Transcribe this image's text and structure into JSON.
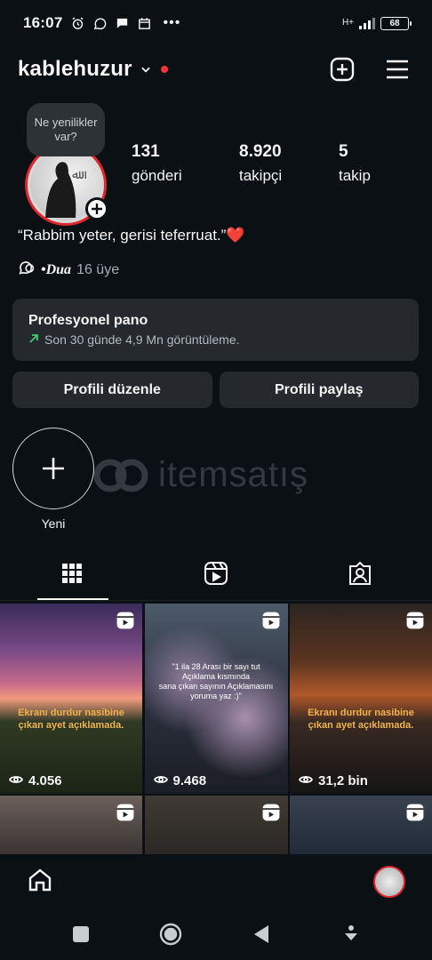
{
  "status_bar": {
    "time": "16:07",
    "battery": "68",
    "network": "H+",
    "left_icons": [
      "alarm-icon",
      "whatsapp-icon",
      "chat-icon",
      "calendar-icon"
    ]
  },
  "header": {
    "username": "kablehuzur"
  },
  "profile": {
    "note_bubble": "Ne yenilikler var?",
    "stats": [
      {
        "number": "131",
        "label": "gönderi"
      },
      {
        "number": "8.920",
        "label": "takipçi"
      },
      {
        "number": "5",
        "label": "takip"
      }
    ],
    "bio": "“Rabbim yeter, gerisi teferruat.”",
    "bio_emoji": "❤️",
    "channel_name": "•Dua",
    "channel_members": "16 üye"
  },
  "dashboard": {
    "title": "Profesyonel pano",
    "subtitle": "Son 30 günde 4,9 Mn görüntüleme."
  },
  "buttons": {
    "edit": "Profili düzenle",
    "share": "Profili paylaş"
  },
  "highlights": {
    "new_label": "Yeni"
  },
  "watermark": {
    "text": "itemsatış"
  },
  "posts": [
    {
      "views": "4.056",
      "caption": "Ekranı durdur nasibine\nçıkan ayet açıklamada."
    },
    {
      "views": "9.468",
      "caption": "\"1 ila 28 Arası bir sayı tut\nAçıklama kısmında\nsana çıkan sayının Açıklamasını\nyoruma yaz :)\""
    },
    {
      "views": "31,2 bin",
      "caption": "Ekranı durdur nasibine\nçıkan ayet açıklamada."
    },
    {
      "views": "",
      "caption": ""
    },
    {
      "views": "",
      "caption": ""
    },
    {
      "views": "",
      "caption": ""
    }
  ],
  "colors": {
    "background": "#0b1014",
    "accent_red": "#ff3040",
    "card": "#25292e",
    "caption_gold": "#f0b24a"
  }
}
